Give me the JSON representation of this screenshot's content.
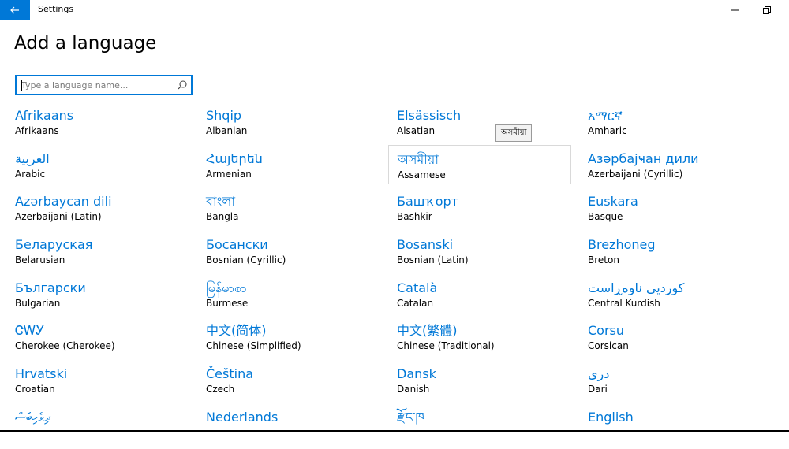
{
  "window": {
    "app_title": "Settings",
    "back_icon": "back-arrow-icon",
    "minimize_icon": "minimize-icon",
    "restore_icon": "restore-icon",
    "accent_color": "#0078d7"
  },
  "page": {
    "title": "Add a language"
  },
  "search": {
    "placeholder": "Type a language name...",
    "value": "",
    "icon": "search-icon"
  },
  "tooltip": {
    "text": "অসমীয়া"
  },
  "languages": [
    {
      "native": "Afrikaans",
      "english": "Afrikaans"
    },
    {
      "native": "Shqip",
      "english": "Albanian"
    },
    {
      "native": "Elsässisch",
      "english": "Alsatian"
    },
    {
      "native": "አማርኛ",
      "english": "Amharic"
    },
    {
      "native": "العربية",
      "english": "Arabic"
    },
    {
      "native": "Հայերեն",
      "english": "Armenian"
    },
    {
      "native": "অসমীয়া",
      "english": "Assamese",
      "hovered": true
    },
    {
      "native": "Азәрбајҹан дили",
      "english": "Azerbaijani (Cyrillic)"
    },
    {
      "native": "Azərbaycan dili",
      "english": "Azerbaijani (Latin)"
    },
    {
      "native": "বাংলা",
      "english": "Bangla"
    },
    {
      "native": "Башҡорт",
      "english": "Bashkir"
    },
    {
      "native": "Euskara",
      "english": "Basque"
    },
    {
      "native": "Беларуская",
      "english": "Belarusian"
    },
    {
      "native": "Босански",
      "english": "Bosnian (Cyrillic)"
    },
    {
      "native": "Bosanski",
      "english": "Bosnian (Latin)"
    },
    {
      "native": "Brezhoneg",
      "english": "Breton"
    },
    {
      "native": "Български",
      "english": "Bulgarian"
    },
    {
      "native": "မြန်မာစာ",
      "english": "Burmese"
    },
    {
      "native": "Català",
      "english": "Catalan"
    },
    {
      "native": "کوردیی ناوەڕاست",
      "english": "Central Kurdish"
    },
    {
      "native": "ᏣᎳᎩ",
      "english": "Cherokee (Cherokee)"
    },
    {
      "native": "中文(简体)",
      "english": "Chinese (Simplified)"
    },
    {
      "native": "中文(繁體)",
      "english": "Chinese (Traditional)"
    },
    {
      "native": "Corsu",
      "english": "Corsican"
    },
    {
      "native": "Hrvatski",
      "english": "Croatian"
    },
    {
      "native": "Čeština",
      "english": "Czech"
    },
    {
      "native": "Dansk",
      "english": "Danish"
    },
    {
      "native": "دری",
      "english": "Dari"
    },
    {
      "native": "ދިވެހިބަސް",
      "english": ""
    },
    {
      "native": "Nederlands",
      "english": ""
    },
    {
      "native": "རྫོང་ཁ",
      "english": ""
    },
    {
      "native": "English",
      "english": ""
    }
  ]
}
